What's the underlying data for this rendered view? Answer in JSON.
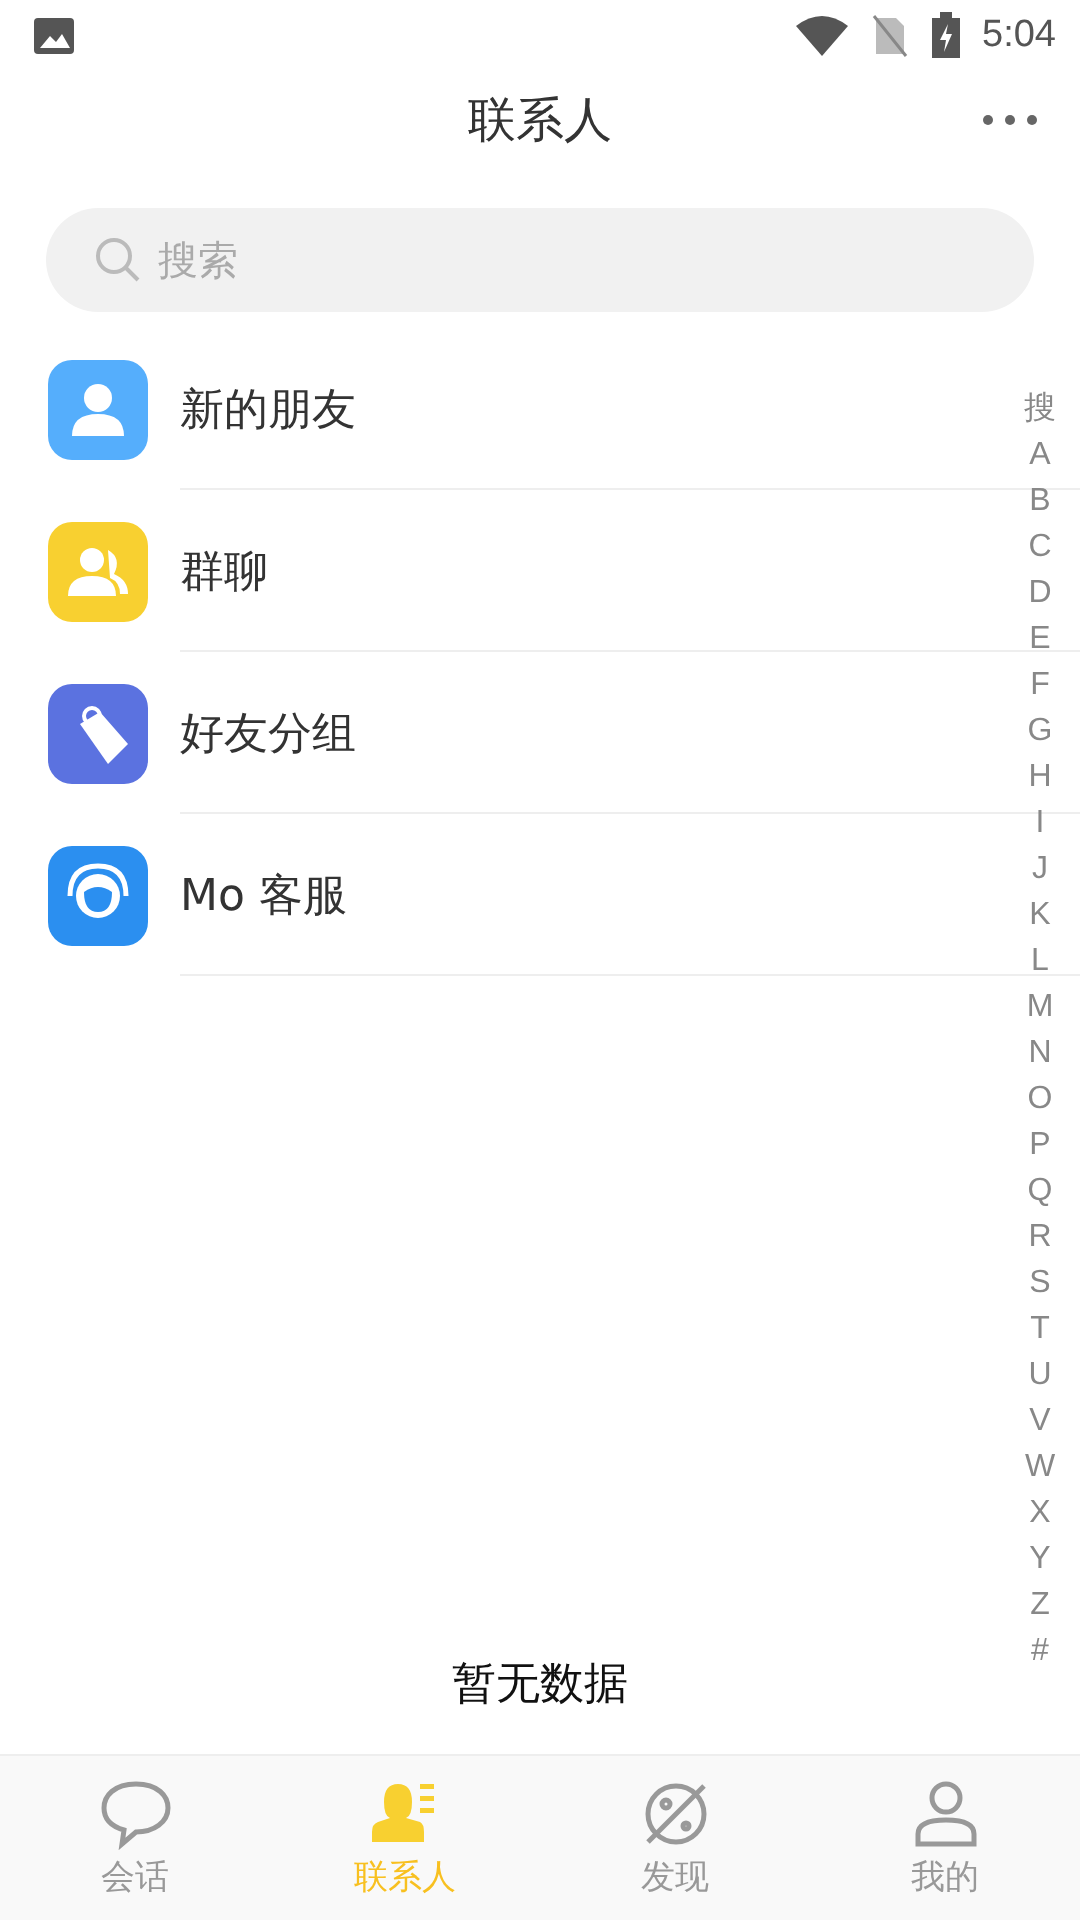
{
  "status_bar": {
    "time": "5:04"
  },
  "header": {
    "title": "联系人"
  },
  "search": {
    "placeholder": "搜索"
  },
  "entries": [
    {
      "kind": "person",
      "label": "新的朋友",
      "color": "#55aefc"
    },
    {
      "kind": "group",
      "label": "群聊",
      "color": "#f8d030"
    },
    {
      "kind": "tag",
      "label": "好友分组",
      "color": "#5b72e0"
    },
    {
      "kind": "headset",
      "label": "Mo 客服",
      "color": "#2b8ff0"
    }
  ],
  "index": [
    "搜",
    "A",
    "B",
    "C",
    "D",
    "E",
    "F",
    "G",
    "H",
    "I",
    "J",
    "K",
    "L",
    "M",
    "N",
    "O",
    "P",
    "Q",
    "R",
    "S",
    "T",
    "U",
    "V",
    "W",
    "X",
    "Y",
    "Z",
    "#"
  ],
  "empty_text": "暂无数据",
  "tabs": [
    {
      "kind": "chat",
      "label": "会话",
      "selected": false
    },
    {
      "kind": "contacts",
      "label": "联系人",
      "selected": true
    },
    {
      "kind": "discover",
      "label": "发现",
      "selected": false
    },
    {
      "kind": "me",
      "label": "我的",
      "selected": false
    }
  ]
}
